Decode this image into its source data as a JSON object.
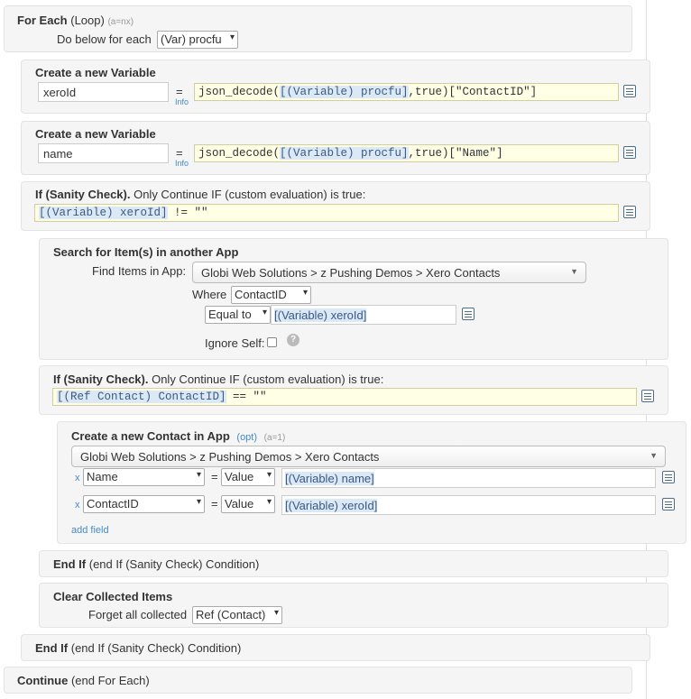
{
  "loop": {
    "title": "For Each",
    "title_paren": "(Loop)",
    "meta": "(a=nx)",
    "do_below_label": "Do below for each",
    "var_select": "(Var) procfu"
  },
  "var1": {
    "title": "Create a new Variable",
    "name_value": "xeroId",
    "equals": "=",
    "info": "Info",
    "code_pre": "json_decode(",
    "code_hl": "[(Variable) procfu]",
    "code_post": ",true)[\"ContactID\"]"
  },
  "var2": {
    "title": "Create a new Variable",
    "name_value": "name",
    "equals": "=",
    "info": "Info",
    "code_pre": "json_decode(",
    "code_hl": "[(Variable) procfu]",
    "code_post": ",true)[\"Name\"]"
  },
  "if1": {
    "title": "If (Sanity Check).",
    "desc": "Only Continue IF (custom evaluation) is true:",
    "code_hl": "[(Variable) xeroId]",
    "code_post": " != \"\""
  },
  "search": {
    "title": "Search for Item(s) in another App",
    "find_label": "Find Items in App:",
    "app_select": "Globi Web Solutions > z Pushing Demos > Xero Contacts",
    "where_label": "Where",
    "field_select": "ContactID",
    "op_select": "Equal to",
    "value_hl": "[(Variable) xeroId]",
    "ignore_self_label": "Ignore Self:",
    "help": "?"
  },
  "if2": {
    "title": "If (Sanity Check).",
    "desc": "Only Continue IF (custom evaluation) is true:",
    "code_hl": "[(Ref Contact) ContactID]",
    "code_post": " == \"\""
  },
  "create": {
    "title": "Create a new Contact in App",
    "opt": "(opt)",
    "meta": "(a=1)",
    "app_select": "Globi Web Solutions > z Pushing Demos > Xero Contacts",
    "rows": [
      {
        "remove": "x",
        "field": "Name",
        "eq": "=",
        "type": "Value",
        "value": "[(Variable) name]"
      },
      {
        "remove": "x",
        "field": "ContactID",
        "eq": "=",
        "type": "Value",
        "value": "[(Variable) xeroId]"
      }
    ],
    "add_field": "add field"
  },
  "endif_inner": {
    "title": "End If",
    "desc": "(end If (Sanity Check) Condition)"
  },
  "clear": {
    "title": "Clear Collected Items",
    "forget_label": "Forget all collected",
    "select": "Ref (Contact)"
  },
  "endif_outer": {
    "title": "End If",
    "desc": "(end If (Sanity Check) Condition)"
  },
  "cont": {
    "title": "Continue",
    "desc": "(end For Each)"
  },
  "icons": {
    "arrow": "▾",
    "edit": "list-edit-icon"
  }
}
